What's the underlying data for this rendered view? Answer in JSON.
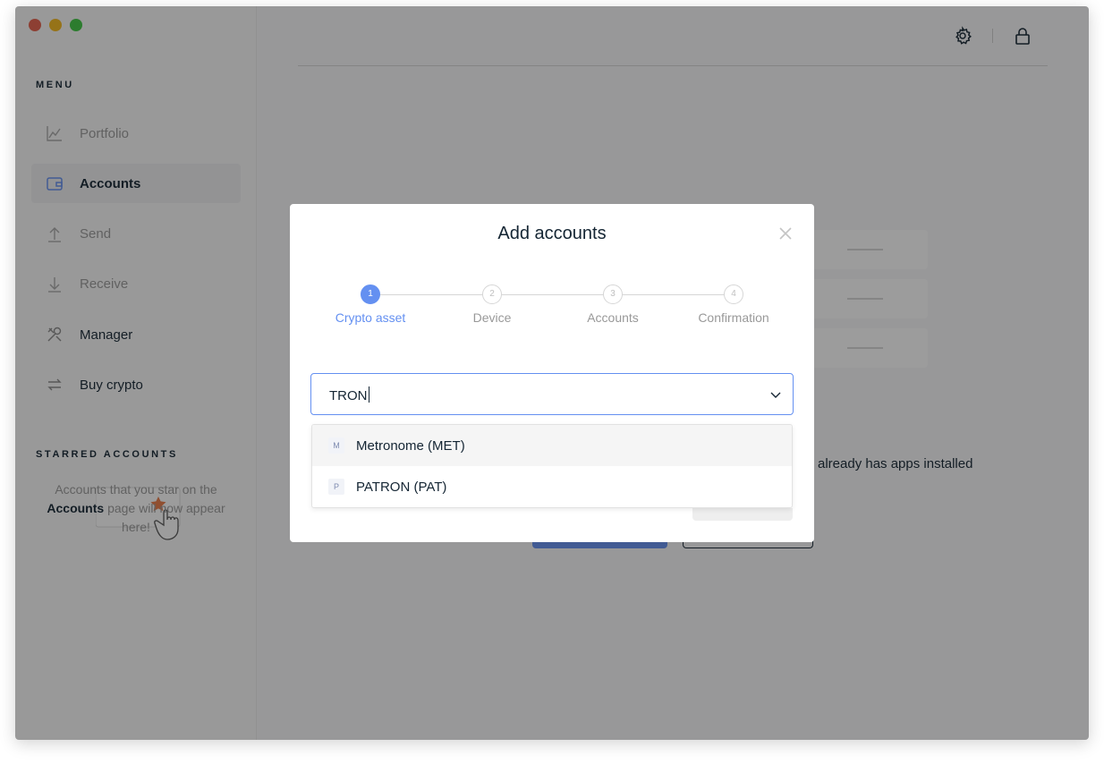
{
  "window": {
    "traffic_colors": [
      "#e55f4b",
      "#f5b81c",
      "#3fc843"
    ]
  },
  "sidebar": {
    "menu_title": "MENU",
    "items": [
      {
        "label": "Portfolio",
        "icon": "chart-icon"
      },
      {
        "label": "Accounts",
        "icon": "wallet-icon",
        "active": true
      },
      {
        "label": "Send",
        "icon": "upload-arrow-icon"
      },
      {
        "label": "Receive",
        "icon": "download-arrow-icon"
      },
      {
        "label": "Manager",
        "icon": "tools-icon"
      },
      {
        "label": "Buy crypto",
        "icon": "exchange-icon"
      }
    ],
    "starred_title": "STARRED ACCOUNTS",
    "starred_empty": {
      "line1": "Accounts that you star on the",
      "bold": "Accounts",
      "line2": " page will now appear",
      "line3": "here!"
    }
  },
  "topbar": {
    "icons": [
      "gear-icon",
      "lock-icon"
    ]
  },
  "background": {
    "text_fragment": "already has apps installed"
  },
  "modal": {
    "title": "Add accounts",
    "steps": [
      {
        "number": "1",
        "label": "Crypto asset",
        "active": true
      },
      {
        "number": "2",
        "label": "Device"
      },
      {
        "number": "3",
        "label": "Accounts"
      },
      {
        "number": "4",
        "label": "Confirmation"
      }
    ],
    "search": {
      "value": "TRON"
    },
    "options": [
      {
        "badge": "M",
        "label": "Metronome (MET)"
      },
      {
        "badge": "P",
        "label": "PATRON (PAT)"
      }
    ]
  },
  "colors": {
    "accent": "#6490f1",
    "text_dark": "#142533",
    "text_muted": "#999999",
    "star": "#ea7a45"
  }
}
